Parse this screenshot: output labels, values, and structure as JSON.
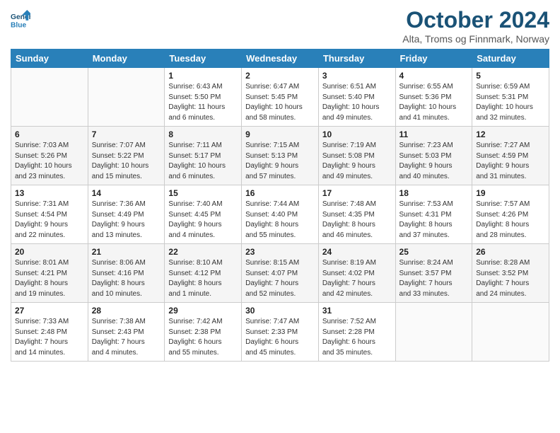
{
  "header": {
    "logo_line1": "General",
    "logo_line2": "Blue",
    "month": "October 2024",
    "location": "Alta, Troms og Finnmark, Norway"
  },
  "weekdays": [
    "Sunday",
    "Monday",
    "Tuesday",
    "Wednesday",
    "Thursday",
    "Friday",
    "Saturday"
  ],
  "weeks": [
    [
      {
        "day": "",
        "info": ""
      },
      {
        "day": "",
        "info": ""
      },
      {
        "day": "1",
        "info": "Sunrise: 6:43 AM\nSunset: 5:50 PM\nDaylight: 11 hours\nand 6 minutes."
      },
      {
        "day": "2",
        "info": "Sunrise: 6:47 AM\nSunset: 5:45 PM\nDaylight: 10 hours\nand 58 minutes."
      },
      {
        "day": "3",
        "info": "Sunrise: 6:51 AM\nSunset: 5:40 PM\nDaylight: 10 hours\nand 49 minutes."
      },
      {
        "day": "4",
        "info": "Sunrise: 6:55 AM\nSunset: 5:36 PM\nDaylight: 10 hours\nand 41 minutes."
      },
      {
        "day": "5",
        "info": "Sunrise: 6:59 AM\nSunset: 5:31 PM\nDaylight: 10 hours\nand 32 minutes."
      }
    ],
    [
      {
        "day": "6",
        "info": "Sunrise: 7:03 AM\nSunset: 5:26 PM\nDaylight: 10 hours\nand 23 minutes."
      },
      {
        "day": "7",
        "info": "Sunrise: 7:07 AM\nSunset: 5:22 PM\nDaylight: 10 hours\nand 15 minutes."
      },
      {
        "day": "8",
        "info": "Sunrise: 7:11 AM\nSunset: 5:17 PM\nDaylight: 10 hours\nand 6 minutes."
      },
      {
        "day": "9",
        "info": "Sunrise: 7:15 AM\nSunset: 5:13 PM\nDaylight: 9 hours\nand 57 minutes."
      },
      {
        "day": "10",
        "info": "Sunrise: 7:19 AM\nSunset: 5:08 PM\nDaylight: 9 hours\nand 49 minutes."
      },
      {
        "day": "11",
        "info": "Sunrise: 7:23 AM\nSunset: 5:03 PM\nDaylight: 9 hours\nand 40 minutes."
      },
      {
        "day": "12",
        "info": "Sunrise: 7:27 AM\nSunset: 4:59 PM\nDaylight: 9 hours\nand 31 minutes."
      }
    ],
    [
      {
        "day": "13",
        "info": "Sunrise: 7:31 AM\nSunset: 4:54 PM\nDaylight: 9 hours\nand 22 minutes."
      },
      {
        "day": "14",
        "info": "Sunrise: 7:36 AM\nSunset: 4:49 PM\nDaylight: 9 hours\nand 13 minutes."
      },
      {
        "day": "15",
        "info": "Sunrise: 7:40 AM\nSunset: 4:45 PM\nDaylight: 9 hours\nand 4 minutes."
      },
      {
        "day": "16",
        "info": "Sunrise: 7:44 AM\nSunset: 4:40 PM\nDaylight: 8 hours\nand 55 minutes."
      },
      {
        "day": "17",
        "info": "Sunrise: 7:48 AM\nSunset: 4:35 PM\nDaylight: 8 hours\nand 46 minutes."
      },
      {
        "day": "18",
        "info": "Sunrise: 7:53 AM\nSunset: 4:31 PM\nDaylight: 8 hours\nand 37 minutes."
      },
      {
        "day": "19",
        "info": "Sunrise: 7:57 AM\nSunset: 4:26 PM\nDaylight: 8 hours\nand 28 minutes."
      }
    ],
    [
      {
        "day": "20",
        "info": "Sunrise: 8:01 AM\nSunset: 4:21 PM\nDaylight: 8 hours\nand 19 minutes."
      },
      {
        "day": "21",
        "info": "Sunrise: 8:06 AM\nSunset: 4:16 PM\nDaylight: 8 hours\nand 10 minutes."
      },
      {
        "day": "22",
        "info": "Sunrise: 8:10 AM\nSunset: 4:12 PM\nDaylight: 8 hours\nand 1 minute."
      },
      {
        "day": "23",
        "info": "Sunrise: 8:15 AM\nSunset: 4:07 PM\nDaylight: 7 hours\nand 52 minutes."
      },
      {
        "day": "24",
        "info": "Sunrise: 8:19 AM\nSunset: 4:02 PM\nDaylight: 7 hours\nand 42 minutes."
      },
      {
        "day": "25",
        "info": "Sunrise: 8:24 AM\nSunset: 3:57 PM\nDaylight: 7 hours\nand 33 minutes."
      },
      {
        "day": "26",
        "info": "Sunrise: 8:28 AM\nSunset: 3:52 PM\nDaylight: 7 hours\nand 24 minutes."
      }
    ],
    [
      {
        "day": "27",
        "info": "Sunrise: 7:33 AM\nSunset: 2:48 PM\nDaylight: 7 hours\nand 14 minutes."
      },
      {
        "day": "28",
        "info": "Sunrise: 7:38 AM\nSunset: 2:43 PM\nDaylight: 7 hours\nand 4 minutes."
      },
      {
        "day": "29",
        "info": "Sunrise: 7:42 AM\nSunset: 2:38 PM\nDaylight: 6 hours\nand 55 minutes."
      },
      {
        "day": "30",
        "info": "Sunrise: 7:47 AM\nSunset: 2:33 PM\nDaylight: 6 hours\nand 45 minutes."
      },
      {
        "day": "31",
        "info": "Sunrise: 7:52 AM\nSunset: 2:28 PM\nDaylight: 6 hours\nand 35 minutes."
      },
      {
        "day": "",
        "info": ""
      },
      {
        "day": "",
        "info": ""
      }
    ]
  ]
}
